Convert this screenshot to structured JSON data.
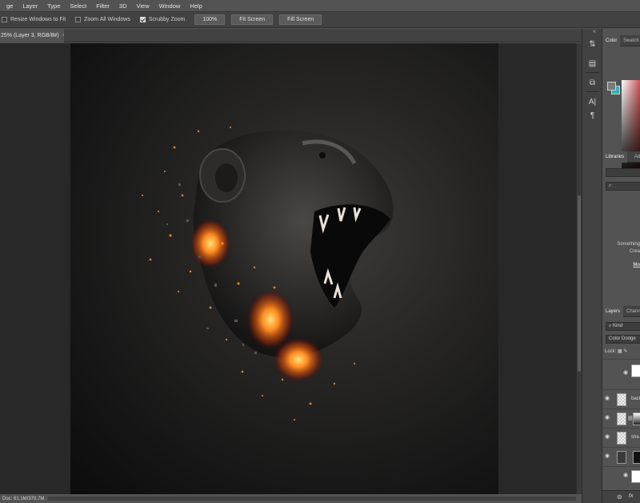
{
  "menubar": {
    "items": [
      "ge",
      "Layer",
      "Type",
      "Select",
      "Filter",
      "3D",
      "View",
      "Window",
      "Help"
    ]
  },
  "options_bar": {
    "resize_windows": "Resize Windows to Fit",
    "zoom_all": "Zoom All Windows",
    "scrubby_zoom": "Scrubby Zoom",
    "btn_100": "100%",
    "btn_fit": "Fit Screen",
    "btn_fill": "Fill Screen"
  },
  "document": {
    "tab_title": "25% (Layer 3, RGB/8#)",
    "tab_close": "×"
  },
  "status": {
    "doc_info": "Doc: 61.1M/370.7M"
  },
  "panels": {
    "collapse_arrows": "«",
    "color_tab": "Color",
    "swatches_tab": "Swatch",
    "libraries_tab": "Libraries",
    "adjust_tab": "Adj",
    "lib_search": "",
    "lib_msg_1": "Something",
    "lib_msg_2": "Crea",
    "lib_link": "Mo",
    "layers_tab": "Layers",
    "channels_tab": "Chann",
    "kind_filter": "Kind",
    "blend_mode": "Color Dodge",
    "lock_label": "Lock:",
    "layers": [
      {
        "name": ""
      },
      {
        "name": "back"
      },
      {
        "name": ""
      },
      {
        "name": "sha"
      },
      {
        "name": ""
      },
      {
        "name": ""
      }
    ],
    "fx": "fx"
  },
  "colors": {
    "accent_swatch": "#2bb5b8",
    "fire": "#ff8a1f"
  }
}
